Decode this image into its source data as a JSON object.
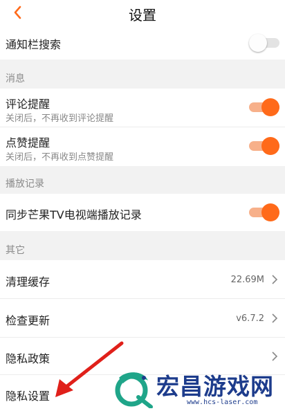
{
  "header": {
    "title": "设置"
  },
  "rows": {
    "notify_search": {
      "label": "通知栏搜索",
      "enabled": false
    },
    "comment_remind": {
      "label": "评论提醒",
      "sub": "关闭后，不再收到评论提醒",
      "enabled": true
    },
    "like_remind": {
      "label": "点赞提醒",
      "sub": "关闭后，不再收到点赞提醒",
      "enabled": true
    },
    "sync_tv": {
      "label": "同步芒果TV电视端播放记录",
      "enabled": true
    },
    "clear_cache": {
      "label": "清理缓存",
      "value": "22.69M"
    },
    "check_update": {
      "label": "检查更新",
      "value": "v6.7.2"
    },
    "privacy_policy": {
      "label": "隐私政策"
    },
    "privacy_settings": {
      "label": "隐私设置"
    }
  },
  "sections": {
    "message": "消息",
    "play_record": "播放记录",
    "other": "其它"
  },
  "watermark": {
    "name": "宏昌游戏网",
    "url": "www.hcs-laser.com"
  },
  "colors": {
    "accent": "#ff6a1a",
    "accent_track": "#f7b08a",
    "annotation_red": "#e0201a",
    "watermark_blue": "#1d3c8c"
  }
}
